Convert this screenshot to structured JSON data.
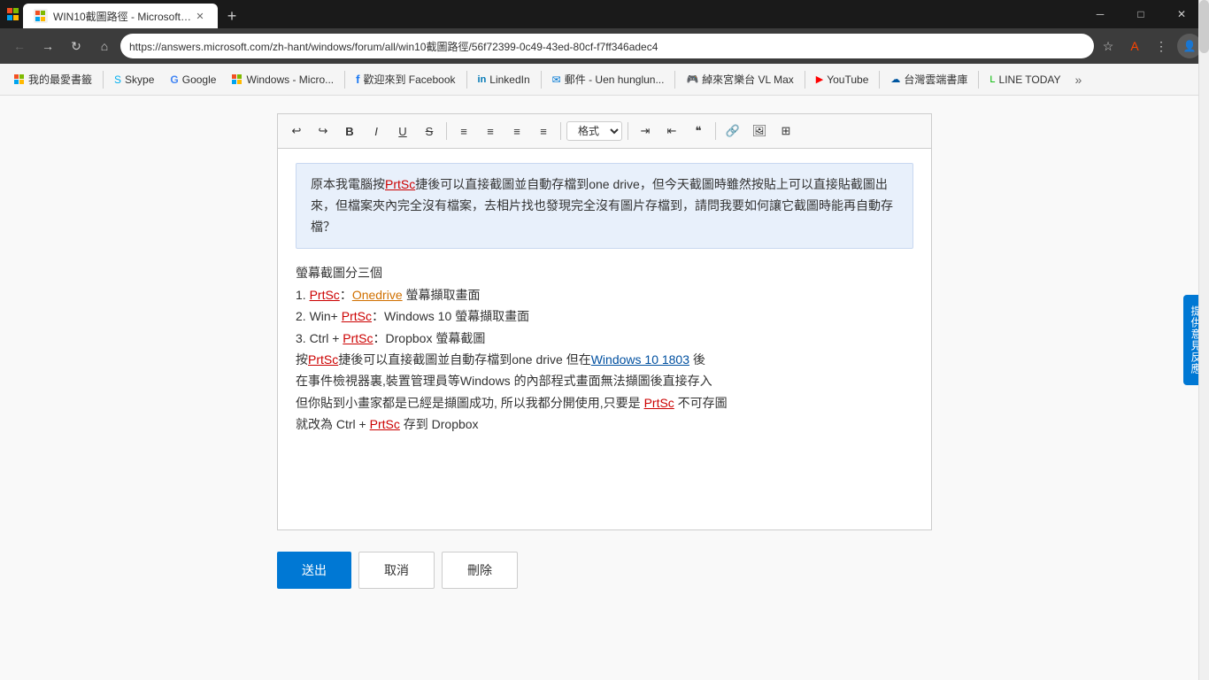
{
  "browser": {
    "tab_title": "WIN10截圖路徑 - Microsoft Co...",
    "tab_new_label": "+",
    "url": "https://answers.microsoft.com/zh-hant/windows/forum/all/win10截圖路徑/56f72399-0c49-43ed-80cf-f7ff346adec4",
    "nav": {
      "back": "←",
      "forward": "→",
      "refresh": "↻",
      "home": "⌂"
    },
    "controls": {
      "minimize": "─",
      "maximize": "□",
      "close": "✕"
    }
  },
  "bookmarks": [
    {
      "id": "my-favorites",
      "label": "我的最愛書籤"
    },
    {
      "id": "skype",
      "label": "Skype"
    },
    {
      "id": "google",
      "label": "Google"
    },
    {
      "id": "windows-ms",
      "label": "Windows - Micro..."
    },
    {
      "id": "facebook",
      "label": "歡迎來到 Facebook"
    },
    {
      "id": "linkedin",
      "label": "LinkedIn"
    },
    {
      "id": "mail",
      "label": "郵件 - Uen hunglun..."
    },
    {
      "id": "bf-vl-max",
      "label": "綽來宮樂台 VL Max"
    },
    {
      "id": "youtube",
      "label": "YouTube"
    },
    {
      "id": "taiwan-cloud",
      "label": "台灣雲端書庫"
    },
    {
      "id": "line-today",
      "label": "LINE TODAY"
    },
    {
      "id": "more",
      "label": "»"
    }
  ],
  "toolbar": {
    "buttons": [
      {
        "id": "undo",
        "symbol": "↩",
        "label": "undo"
      },
      {
        "id": "redo",
        "symbol": "↪",
        "label": "redo"
      },
      {
        "id": "bold",
        "symbol": "B",
        "label": "bold"
      },
      {
        "id": "italic",
        "symbol": "I",
        "label": "italic"
      },
      {
        "id": "underline",
        "symbol": "U",
        "label": "underline"
      },
      {
        "id": "strikethrough",
        "symbol": "S̶",
        "label": "strikethrough"
      },
      {
        "id": "align-left",
        "symbol": "≡",
        "label": "align-left"
      },
      {
        "id": "align-center",
        "symbol": "≡",
        "label": "align-center"
      },
      {
        "id": "align-right",
        "symbol": "≡",
        "label": "align-right"
      },
      {
        "id": "justify",
        "symbol": "≡",
        "label": "justify"
      },
      {
        "id": "format-select",
        "symbol": "格式",
        "label": "format"
      },
      {
        "id": "indent-increase",
        "symbol": "⇥",
        "label": "indent"
      },
      {
        "id": "indent-decrease",
        "symbol": "⇤",
        "label": "outdent"
      },
      {
        "id": "blockquote",
        "symbol": "❝",
        "label": "blockquote"
      },
      {
        "id": "link",
        "symbol": "🔗",
        "label": "link"
      },
      {
        "id": "image",
        "symbol": "🖼",
        "label": "image"
      },
      {
        "id": "table",
        "symbol": "⊞",
        "label": "table"
      }
    ]
  },
  "quoted_text": "原本我電腦按PrtSc捷後可以直接截圖並自動存檔到one drive，但今天截圖時雖然按貼上可以直接貼截圖出來，但檔案夾內完全沒有檔案，去相片找也發現完全沒有圖片存檔到，請問我要如何讓它截圖時能再自動存檔？",
  "content": {
    "intro": "螢幕截圖分三個",
    "item1_prefix": "1. ",
    "item1_key": "PrtSc",
    "item1_sep": "：",
    "item1_link": "Onedrive",
    "item1_text": " 螢幕擷取畫面",
    "item2_prefix": "2. Win+ ",
    "item2_key": "PrtSc",
    "item2_text": "：Windows 10 螢幕擷取畫面",
    "item3_prefix": "3. Ctrl + ",
    "item3_key": "PrtSc",
    "item3_text": "：Dropbox 螢幕截圖",
    "line4_prefix": "按",
    "line4_key": "PrtSc",
    "line4_text1": "捷後可以直接截圖並自動存檔到one drive 但在",
    "line4_win": "Windows 10 1803",
    "line4_text2": " 後",
    "line5": "在事件檢視器裏,裝置管理員等Windows 的內部程式畫面無法擷圖後直接存入",
    "line6_prefix": "但你貼到小畫家都是已經是擷圖成功, 所以我都分開使用,只要是 ",
    "line6_key": "PrtSc",
    "line6_text": " 不可存圖",
    "line7_prefix": "就改為 Ctrl + ",
    "line7_key": "PrtSc",
    "line7_text": " 存到 Dropbox"
  },
  "buttons": {
    "submit": "送出",
    "cancel": "取消",
    "delete": "刪除"
  },
  "feedback": {
    "label": "提供意見反應"
  }
}
